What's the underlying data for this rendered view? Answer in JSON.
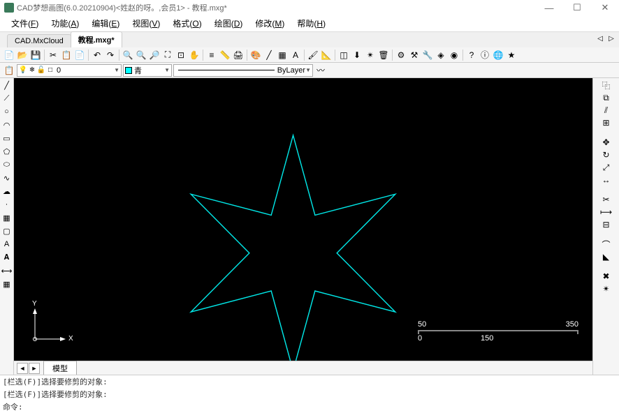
{
  "titlebar": {
    "text": "CAD梦想画图(6.0.20210904)<姓赵的呀。,会员1> - 教程.mxg*"
  },
  "win_controls": {
    "min": "—",
    "max": "☐",
    "close": "✕"
  },
  "menu": [
    {
      "label": "文件",
      "key": "F"
    },
    {
      "label": "功能",
      "key": "A"
    },
    {
      "label": "编辑",
      "key": "E"
    },
    {
      "label": "视图",
      "key": "V"
    },
    {
      "label": "格式",
      "key": "O"
    },
    {
      "label": "绘图",
      "key": "D"
    },
    {
      "label": "修改",
      "key": "M"
    },
    {
      "label": "帮助",
      "key": "H"
    }
  ],
  "doc_tabs": {
    "items": [
      {
        "label": "CAD.MxCloud",
        "active": false
      },
      {
        "label": "教程.mxg*",
        "active": true
      }
    ],
    "nav_left": "◁",
    "nav_right": "▷"
  },
  "main_toolbar": [
    "new",
    "open",
    "save",
    "sep",
    "cut",
    "copy",
    "paste",
    "sep",
    "undo",
    "redo",
    "sep",
    "find",
    "zoom-in",
    "zoom-out",
    "zoom-window",
    "zoom-extents",
    "pan",
    "sep",
    "layer",
    "dim",
    "print",
    "sep",
    "color",
    "line",
    "hatch",
    "text",
    "sep",
    "match",
    "measure",
    "sep",
    "block",
    "insert",
    "explode",
    "purge",
    "sep",
    "tool1",
    "tool2",
    "tool3",
    "tool4",
    "tool5",
    "sep",
    "help1",
    "help2",
    "help3",
    "help4"
  ],
  "layer_bar": {
    "layer_name": "0",
    "color_name": "青",
    "linetype": "ByLayer"
  },
  "left_tools": [
    "line",
    "pline",
    "circle",
    "arc",
    "rect",
    "polygon",
    "ellipse",
    "spline",
    "cloud",
    "point",
    "hatch",
    "region",
    "text-a",
    "mtext",
    "dim",
    "table"
  ],
  "right_tools": [
    "copy",
    "mirror",
    "offset",
    "array",
    "sep",
    "move",
    "rotate",
    "scale",
    "stretch",
    "sep",
    "trim",
    "extend",
    "break",
    "sep",
    "fillet",
    "chamfer",
    "sep",
    "erase",
    "explode"
  ],
  "canvas": {
    "ucs_x": "X",
    "ucs_y": "Y",
    "scale": {
      "v0": "0",
      "v50": "50",
      "v150": "150",
      "v350": "350"
    },
    "star_color": "#00e5e5"
  },
  "model_tabs": {
    "nav_left": "◄",
    "nav_right": "►",
    "current": "模型"
  },
  "command": {
    "history": [
      "[栏选(F)]选择要修剪的对象:",
      "[栏选(F)]选择要修剪的对象:"
    ],
    "prompt": "命令:"
  }
}
